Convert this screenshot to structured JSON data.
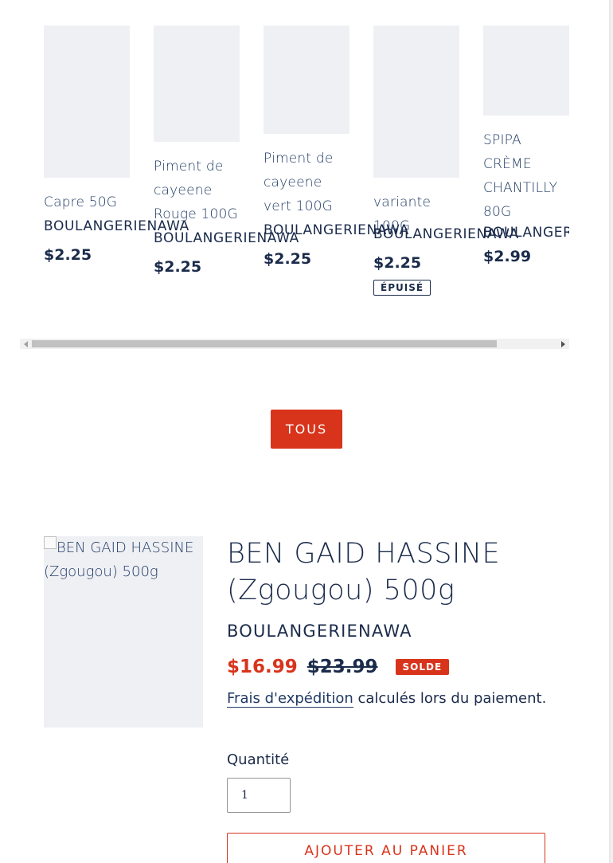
{
  "related_products": [
    {
      "title": "Capre 50G",
      "vendor": "BOULANGERIENAWA",
      "price": "$2.25",
      "sold_out": ""
    },
    {
      "title": "Piment de cayeene Rouge 100G",
      "vendor": "BOULANGERIENAWA",
      "price": "$2.25",
      "sold_out": ""
    },
    {
      "title": "Piment de cayeene vert 100G",
      "vendor": "BOULANGERIENAWA",
      "price": "$2.25",
      "sold_out": ""
    },
    {
      "title": "variante 100G",
      "vendor": "BOULANGERIENAWA",
      "price": "$2.25",
      "sold_out": "ÉPUISÉ"
    },
    {
      "title": "SPIPA CRÈME CHANTILLY 80G",
      "vendor": "BOULANGERIENAWA",
      "price": "$2.99",
      "sold_out": ""
    }
  ],
  "view_all_label": "TOUS",
  "product": {
    "image_alt": "BEN GAID HASSINE (Zgougou) 500g",
    "title": "BEN GAID HASSINE (Zgougou) 500g",
    "vendor": "BOULANGERIENAWA",
    "sale_price": "$16.99",
    "regular_price": "$23.99",
    "sale_badge": "SOLDE",
    "shipping_link": "Frais d'expédition",
    "shipping_text": " calculés lors du paiement.",
    "quantity_label": "Quantité",
    "quantity_value": "1",
    "add_to_cart_label": "AJOUTER AU PANIER"
  },
  "colors": {
    "accent": "#d8341c",
    "text": "#1b2b4b",
    "link": "#1f3a64",
    "placeholder_bg": "#eff0f4"
  }
}
